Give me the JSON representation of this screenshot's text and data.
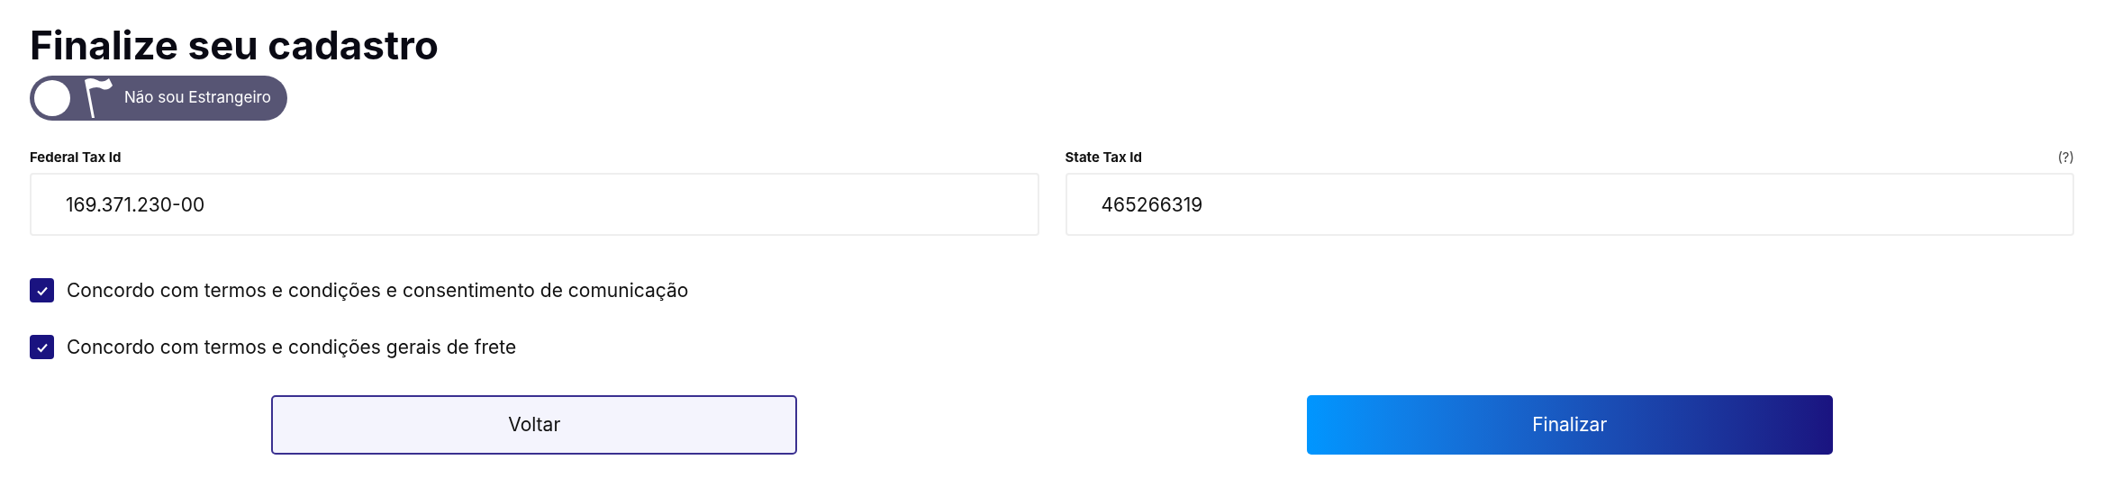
{
  "title": "Finalize seu cadastro",
  "foreigner_toggle": {
    "label": "Não sou Estrangeiro",
    "on": false
  },
  "fields": [
    {
      "label": "Federal Tax Id",
      "value": "169.371.230-00"
    },
    {
      "label": "State Tax Id",
      "value": "465266319",
      "help": "(?)"
    }
  ],
  "checkboxes": [
    {
      "label": "Concordo com termos e condições e consentimento de comunicação",
      "checked": true
    },
    {
      "label": "Concordo com termos e condições gerais de frete",
      "checked": true
    }
  ],
  "buttons": [
    {
      "label": "Voltar",
      "kind": "secondary"
    },
    {
      "label": "Finalizar",
      "kind": "primary"
    }
  ]
}
